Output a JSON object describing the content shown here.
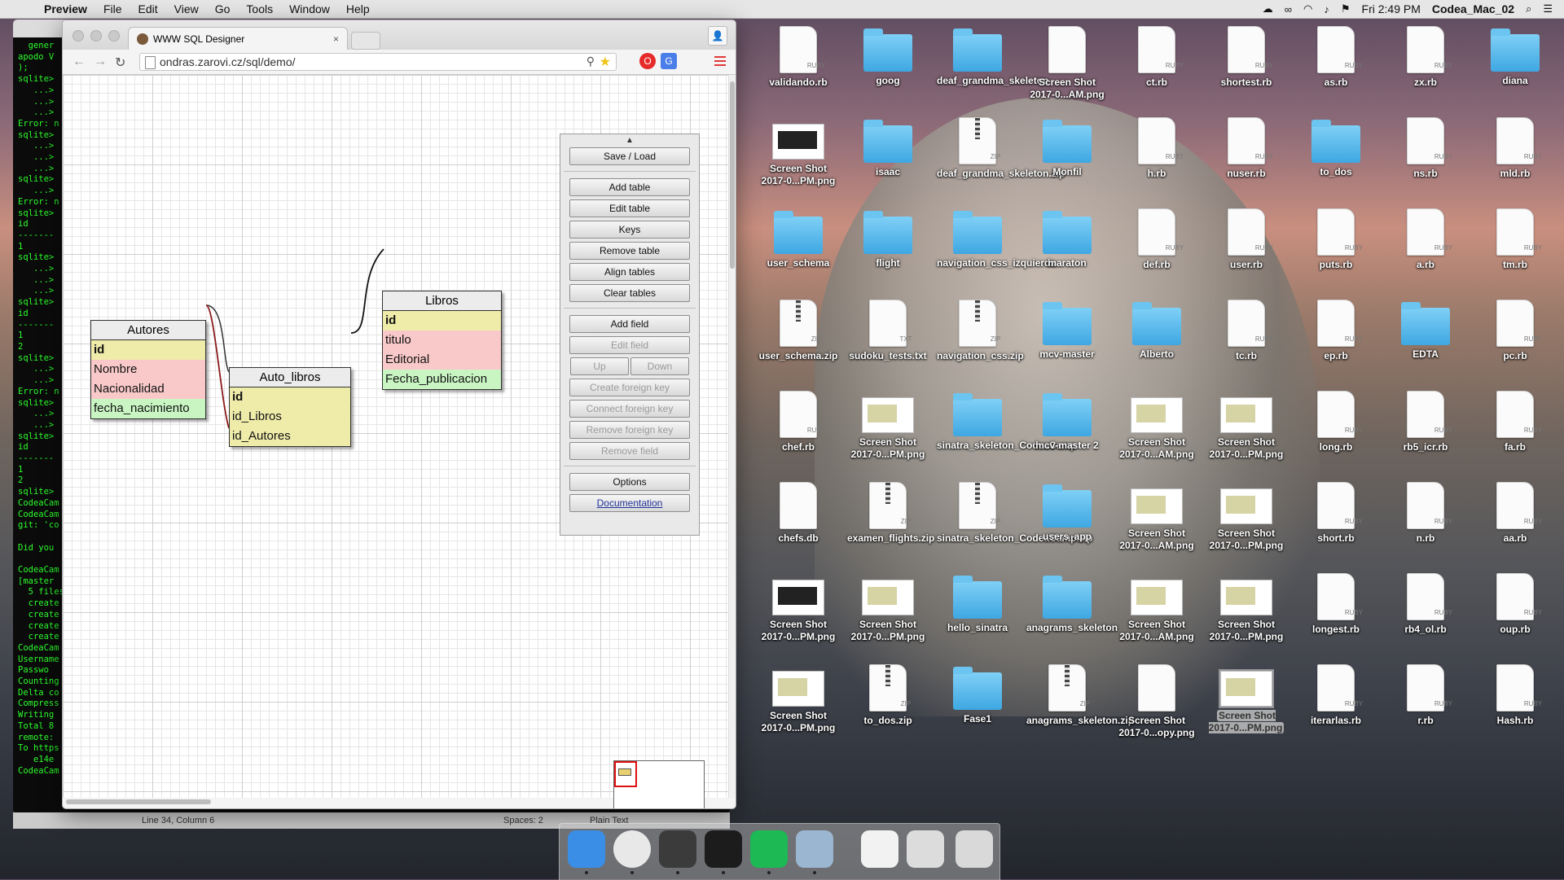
{
  "menubar": {
    "app": "Preview",
    "items": [
      "File",
      "Edit",
      "View",
      "Go",
      "Tools",
      "Window",
      "Help"
    ],
    "clock": "Fri 2:49 PM",
    "user": "Codea_Mac_02"
  },
  "terminal": {
    "lines": [
      "  gener",
      "apodo V",
      ");",
      "sqlite>",
      "   ...>",
      "   ...>",
      "   ...>",
      "Error: n",
      "sqlite>",
      "   ...>",
      "   ...>",
      "   ...>",
      "sqlite>",
      "   ...>",
      "Error: n",
      "sqlite>",
      "id",
      "-------",
      "1",
      "sqlite>",
      "   ...>",
      "   ...>",
      "   ...>",
      "sqlite>",
      "id",
      "-------",
      "1",
      "2",
      "sqlite>",
      "   ...>",
      "   ...>",
      "Error: n",
      "sqlite>",
      "   ...>",
      "   ...>",
      "sqlite>",
      "id",
      "-------",
      "1",
      "2",
      "sqlite>",
      "CodeaCam",
      "CodeaCam",
      "git: 'co",
      "",
      "Did you",
      "",
      "CodeaCam",
      "[master",
      "  5 files",
      "  create",
      "  create",
      "  create",
      "  create",
      "CodeaCam",
      "Username",
      "Passwo",
      "Counting",
      "Delta co",
      "Compress",
      "Writing",
      "Total 8",
      "remote:",
      "To https",
      "   e14e",
      "CodeaCam"
    ]
  },
  "editor_status": {
    "position": "Line 34, Column 6",
    "spaces": "Spaces: 2",
    "syntax": "Plain Text"
  },
  "browser": {
    "tab_title": "WWW SQL Designer",
    "url": "ondras.zarovi.cz/sql/demo/"
  },
  "tables": [
    {
      "name": "Autores",
      "fields": [
        {
          "name": "id",
          "kind": "pk"
        },
        {
          "name": "Nombre",
          "kind": "tx"
        },
        {
          "name": "Nacionalidad",
          "kind": "tx"
        },
        {
          "name": "fecha_nacimiento",
          "kind": "dt"
        }
      ]
    },
    {
      "name": "Auto_libros",
      "fields": [
        {
          "name": "id",
          "kind": "pk"
        },
        {
          "name": "id_Libros",
          "kind": "fk"
        },
        {
          "name": "id_Autores",
          "kind": "fk"
        }
      ]
    },
    {
      "name": "Libros",
      "fields": [
        {
          "name": "id",
          "kind": "pk"
        },
        {
          "name": "titulo",
          "kind": "tx"
        },
        {
          "name": "Editorial",
          "kind": "tx"
        },
        {
          "name": "Fecha_publicacion",
          "kind": "dt"
        }
      ]
    }
  ],
  "panel": {
    "save_load": "Save / Load",
    "add_table": "Add table",
    "edit_table": "Edit table",
    "keys": "Keys",
    "remove_table": "Remove table",
    "align_tables": "Align tables",
    "clear_tables": "Clear tables",
    "add_field": "Add field",
    "edit_field": "Edit field",
    "up": "Up",
    "down": "Down",
    "create_fk": "Create foreign key",
    "connect_fk": "Connect foreign key",
    "remove_fk": "Remove foreign key",
    "remove_field": "Remove field",
    "options": "Options",
    "documentation": "Documentation"
  },
  "desktop": [
    {
      "label": "validando.rb",
      "type": "doc",
      "kind": "RUBY"
    },
    {
      "label": "goog",
      "type": "folder"
    },
    {
      "label": "deaf_grandma_skeleton",
      "type": "folder"
    },
    {
      "label": "Screen Shot 2017-0...AM.png",
      "type": "doc",
      "kind": ""
    },
    {
      "label": "ct.rb",
      "type": "doc",
      "kind": "RUBY"
    },
    {
      "label": "shortest.rb",
      "type": "doc",
      "kind": "RUBY"
    },
    {
      "label": "as.rb",
      "type": "doc",
      "kind": "RUBY"
    },
    {
      "label": "zx.rb",
      "type": "doc",
      "kind": "RUBY"
    },
    {
      "label": "diana",
      "type": "folder"
    },
    {
      "label": "Screen Shot 2017-0...PM.png",
      "type": "shotdark"
    },
    {
      "label": "isaac",
      "type": "folder"
    },
    {
      "label": "deaf_grandma_skeleton.zip",
      "type": "zip",
      "kind": "ZIP"
    },
    {
      "label": "Monfil",
      "type": "folder"
    },
    {
      "label": "h.rb",
      "type": "doc",
      "kind": "RUBY"
    },
    {
      "label": "nuser.rb",
      "type": "doc",
      "kind": "RUBY"
    },
    {
      "label": "to_dos",
      "type": "folder"
    },
    {
      "label": "ns.rb",
      "type": "doc",
      "kind": "RUBY"
    },
    {
      "label": "mld.rb",
      "type": "doc",
      "kind": "RUBY"
    },
    {
      "label": "user_schema",
      "type": "folder"
    },
    {
      "label": "flight",
      "type": "folder"
    },
    {
      "label": "navigation_css_izquierda",
      "type": "folder"
    },
    {
      "label": "maraton",
      "type": "folder"
    },
    {
      "label": "def.rb",
      "type": "doc",
      "kind": "RUBY"
    },
    {
      "label": "user.rb",
      "type": "doc",
      "kind": "RUBY"
    },
    {
      "label": "puts.rb",
      "type": "doc",
      "kind": "RUBY"
    },
    {
      "label": "a.rb",
      "type": "doc",
      "kind": "RUBY"
    },
    {
      "label": "tm.rb",
      "type": "doc",
      "kind": "RUBY"
    },
    {
      "label": "user_schema.zip",
      "type": "zip",
      "kind": "ZIP"
    },
    {
      "label": "sudoku_tests.txt",
      "type": "doc",
      "kind": "TXT"
    },
    {
      "label": "navigation_css.zip",
      "type": "zip",
      "kind": "ZIP"
    },
    {
      "label": "mcv-master",
      "type": "folder"
    },
    {
      "label": "Alberto",
      "type": "folder"
    },
    {
      "label": "tc.rb",
      "type": "doc",
      "kind": "RUBY"
    },
    {
      "label": "ep.rb",
      "type": "doc",
      "kind": "RUBY"
    },
    {
      "label": "EDTA",
      "type": "folder"
    },
    {
      "label": "pc.rb",
      "type": "doc",
      "kind": "RUBY"
    },
    {
      "label": "chef.rb",
      "type": "doc",
      "kind": "RUBY"
    },
    {
      "label": "Screen Shot 2017-0...PM.png",
      "type": "shot"
    },
    {
      "label": "sinatra_skeleton_CodeaCamp",
      "type": "folder"
    },
    {
      "label": "mcv-master 2",
      "type": "folder"
    },
    {
      "label": "Screen Shot 2017-0...AM.png",
      "type": "shot"
    },
    {
      "label": "Screen Shot 2017-0...PM.png",
      "type": "shot"
    },
    {
      "label": "long.rb",
      "type": "doc",
      "kind": "RUBY"
    },
    {
      "label": "rb5_icr.rb",
      "type": "doc",
      "kind": "RUBY"
    },
    {
      "label": "fa.rb",
      "type": "doc",
      "kind": "RUBY"
    },
    {
      "label": "chefs.db",
      "type": "doc",
      "kind": ""
    },
    {
      "label": "examen_flights.zip",
      "type": "zip",
      "kind": "ZIP"
    },
    {
      "label": "sinatra_skeleton_CodeaCamp.zip",
      "type": "zip",
      "kind": "ZIP"
    },
    {
      "label": "users_app",
      "type": "folder"
    },
    {
      "label": "Screen Shot 2017-0...AM.png",
      "type": "shot"
    },
    {
      "label": "Screen Shot 2017-0...PM.png",
      "type": "shot"
    },
    {
      "label": "short.rb",
      "type": "doc",
      "kind": "RUBY"
    },
    {
      "label": "n.rb",
      "type": "doc",
      "kind": "RUBY"
    },
    {
      "label": "aa.rb",
      "type": "doc",
      "kind": "RUBY"
    },
    {
      "label": "Screen Shot 2017-0...PM.png",
      "type": "shotdark"
    },
    {
      "label": "Screen Shot 2017-0...PM.png",
      "type": "shot"
    },
    {
      "label": "hello_sinatra",
      "type": "folder"
    },
    {
      "label": "anagrams_skeleton",
      "type": "folder"
    },
    {
      "label": "Screen Shot 2017-0...AM.png",
      "type": "shot"
    },
    {
      "label": "Screen Shot 2017-0...PM.png",
      "type": "shot"
    },
    {
      "label": "longest.rb",
      "type": "doc",
      "kind": "RUBY"
    },
    {
      "label": "rb4_ol.rb",
      "type": "doc",
      "kind": "RUBY"
    },
    {
      "label": "oup.rb",
      "type": "doc",
      "kind": "RUBY"
    },
    {
      "label": "Screen Shot 2017-0...PM.png",
      "type": "shot"
    },
    {
      "label": "to_dos.zip",
      "type": "zip",
      "kind": "ZIP"
    },
    {
      "label": "Fase1",
      "type": "folder"
    },
    {
      "label": "anagrams_skeleton.zip",
      "type": "zip",
      "kind": "ZIP"
    },
    {
      "label": "Screen Shot 2017-0...opy.png",
      "type": "doc",
      "kind": ""
    },
    {
      "label": "Screen Shot 2017-0...PM.png",
      "type": "shot",
      "selected": true
    },
    {
      "label": "iterarlas.rb",
      "type": "doc",
      "kind": "RUBY"
    },
    {
      "label": "r.rb",
      "type": "doc",
      "kind": "RUBY"
    },
    {
      "label": "Hash.rb",
      "type": "doc",
      "kind": "RUBY"
    }
  ],
  "dock": [
    {
      "name": "Finder",
      "color": "#3a8ee6"
    },
    {
      "name": "Google Chrome",
      "color": "#e8e8e8"
    },
    {
      "name": "Sublime Text",
      "color": "#3b3b3b"
    },
    {
      "name": "Terminal",
      "color": "#1c1c1c"
    },
    {
      "name": "Spotify",
      "color": "#1db954"
    },
    {
      "name": "Preview",
      "color": "#9bb6d0"
    },
    {
      "name": "Document",
      "color": "#f2f2f2"
    },
    {
      "name": "Chrome window",
      "color": "#dcdcdc"
    },
    {
      "name": "Trash",
      "color": "#d9d9d9"
    }
  ]
}
